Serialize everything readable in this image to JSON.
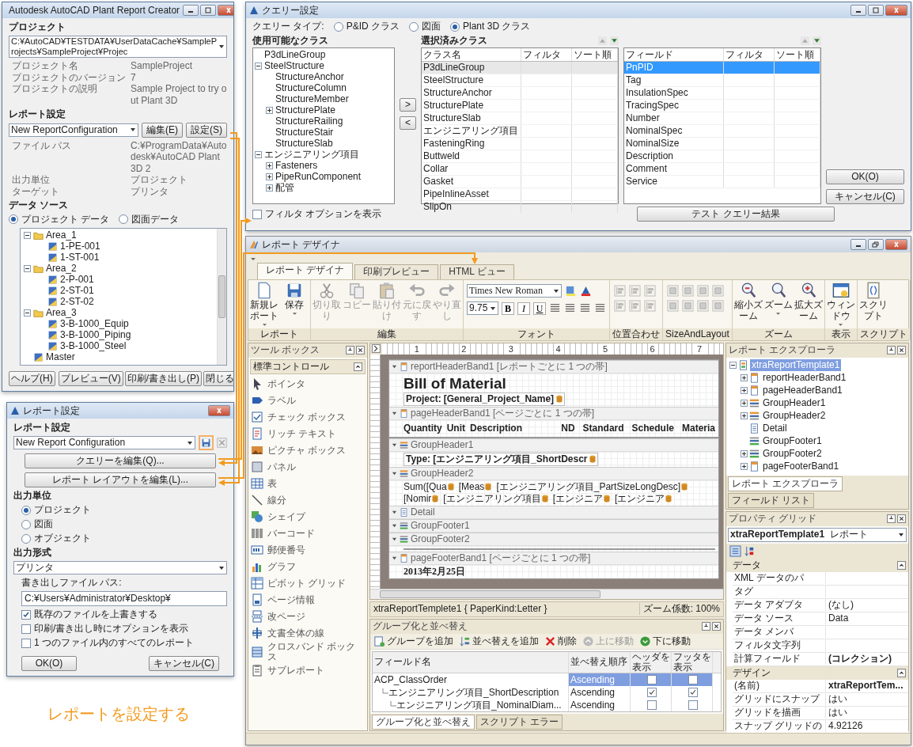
{
  "caption": "レポートを設定する",
  "creator": {
    "title": "Autodesk AutoCAD Plant Report Creator",
    "project_label": "プロジェクト",
    "project_path": "C:¥AutoCAD¥TESTDATA¥UserDataCache¥SampleProjects¥SampleProject¥Projec",
    "project_info": [
      {
        "label": "プロジェクト名",
        "value": "SampleProject"
      },
      {
        "label": "プロジェクトのバージョン",
        "value": "7"
      },
      {
        "label": "プロジェクトの説明",
        "value": "Sample Project to try out Plant 3D"
      }
    ],
    "report_label": "レポート設定",
    "report_config": "New ReportConfiguration",
    "report_buttons": [
      "編集(E)",
      "設定(S)"
    ],
    "report_info": [
      {
        "label": "ファイル パス",
        "value": "C:¥ProgramData¥Autodesk¥AutoCAD Plant 3D 2"
      },
      {
        "label": "出力単位",
        "value": "プロジェクト"
      },
      {
        "label": "ターゲット",
        "value": "プリンタ"
      }
    ],
    "datasource_label": "データ ソース",
    "datasource_options": [
      {
        "label": "プロジェクト データ",
        "selected": true
      },
      {
        "label": "図面データ",
        "selected": false
      }
    ],
    "tree": [
      {
        "label": "Area_1",
        "kind": "folder",
        "expanded": true,
        "children": [
          {
            "label": "1-PE-001",
            "kind": "drawing"
          },
          {
            "label": "1-ST-001",
            "kind": "drawing"
          }
        ]
      },
      {
        "label": "Area_2",
        "kind": "folder",
        "expanded": true,
        "children": [
          {
            "label": "2-P-001",
            "kind": "drawing"
          },
          {
            "label": "2-ST-01",
            "kind": "drawing"
          },
          {
            "label": "2-ST-02",
            "kind": "drawing"
          }
        ]
      },
      {
        "label": "Area_3",
        "kind": "folder",
        "expanded": true,
        "children": [
          {
            "label": "3-B-1000_Equip",
            "kind": "drawing"
          },
          {
            "label": "3-B-1000_Piping",
            "kind": "drawing"
          },
          {
            "label": "3-B-1000_Steel",
            "kind": "drawing"
          }
        ]
      },
      {
        "label": "Master",
        "kind": "drawing"
      }
    ],
    "help_button": "ヘルプ(H)",
    "buttons": [
      "プレビュー(V)",
      "印刷/書き出し(P)",
      "閉じる"
    ]
  },
  "settings": {
    "title": "レポート設定",
    "config_label": "レポート設定",
    "config": "New Report Configuration",
    "edit_buttons": [
      "クエリーを編集(Q)...",
      "レポート レイアウトを編集(L)..."
    ],
    "unit_label": "出力単位",
    "units": [
      {
        "label": "プロジェクト",
        "selected": true
      },
      {
        "label": "図面",
        "selected": false
      },
      {
        "label": "オブジェクト",
        "selected": false
      }
    ],
    "format_label": "出力形式",
    "format": "プリンタ",
    "path_label": "書き出しファイル パス:",
    "path": "C:¥Users¥Administrator¥Desktop¥",
    "options": [
      {
        "label": "既存のファイルを上書きする",
        "checked": true
      },
      {
        "label": "印刷/書き出し時にオプションを表示",
        "checked": false
      },
      {
        "label": "1 つのファイル内のすべてのレポート",
        "checked": false
      }
    ],
    "buttons": [
      "OK(O)",
      "キャンセル(C)"
    ]
  },
  "query": {
    "title": "クエリー設定",
    "type_label": "クエリー タイプ:",
    "types": [
      {
        "label": "P&ID クラス",
        "selected": false
      },
      {
        "label": "図面",
        "selected": false
      },
      {
        "label": "Plant 3D クラス",
        "selected": true
      }
    ],
    "available_label": "使用可能なクラス",
    "available": [
      {
        "label": "P3dLineGroup"
      },
      {
        "label": "SteelStructure",
        "expanded": true,
        "children": [
          {
            "label": "StructureAnchor"
          },
          {
            "label": "StructureColumn"
          },
          {
            "label": "StructureMember"
          },
          {
            "label": "StructurePlate",
            "expanded": false
          },
          {
            "label": "StructureRailing"
          },
          {
            "label": "StructureStair"
          },
          {
            "label": "StructureSlab"
          }
        ]
      },
      {
        "label": "エンジニアリング項目",
        "expanded": true,
        "children": [
          {
            "label": "Fasteners",
            "expanded": false
          },
          {
            "label": "PipeRunComponent",
            "expanded": false
          },
          {
            "label": "配管",
            "expanded": false
          }
        ]
      }
    ],
    "move_buttons": [
      ">",
      "<"
    ],
    "selected_label": "選択済みクラス",
    "class_columns": [
      "クラス名",
      "フィルタ",
      "ソート順"
    ],
    "classes": [
      {
        "name": "P3dLineGroup",
        "selected": true
      },
      {
        "name": "SteelStructure",
        "selected": false
      },
      {
        "name": "StructureAnchor",
        "selected": false
      },
      {
        "name": "StructurePlate",
        "selected": false
      },
      {
        "name": "StructureSlab",
        "selected": false
      },
      {
        "name": "エンジニアリング項目",
        "selected": false
      },
      {
        "name": "FasteningRing",
        "selected": false
      },
      {
        "name": "Buttweld",
        "selected": false
      },
      {
        "name": "Collar",
        "selected": false
      },
      {
        "name": "Gasket",
        "selected": false
      },
      {
        "name": "PipeInlineAsset",
        "selected": false
      },
      {
        "name": "SlipOn",
        "selected": false
      }
    ],
    "field_columns": [
      "フィールド",
      "フィルタ",
      "ソート順"
    ],
    "fields": [
      {
        "name": "PnPID",
        "selected": true
      },
      {
        "name": "Tag",
        "selected": false
      },
      {
        "name": "InsulationSpec",
        "selected": false
      },
      {
        "name": "TracingSpec",
        "selected": false
      },
      {
        "name": "Number",
        "selected": false
      },
      {
        "name": "NominalSpec",
        "selected": false
      },
      {
        "name": "NominalSize",
        "selected": false
      },
      {
        "name": "Description",
        "selected": false
      },
      {
        "name": "Comment",
        "selected": false
      },
      {
        "name": "Service",
        "selected": false
      }
    ],
    "test_button": "テスト クエリー結果",
    "show_option": {
      "label": "フィルタ オプションを表示",
      "checked": false
    },
    "buttons": [
      "OK(O)",
      "キャンセル(C)"
    ]
  },
  "designer": {
    "title": "レポート デザイナ",
    "tabs": [
      {
        "label": "レポート デザイナ",
        "selected": true
      },
      {
        "label": "印刷プレビュー",
        "selected": false
      },
      {
        "label": "HTML ビュー",
        "selected": false
      }
    ],
    "ribbon": [
      {
        "kind": "buttons",
        "label": "レポート",
        "items": [
          {
            "label": "新規レポート",
            "kind": "new",
            "disabled": false,
            "dropdown": true
          },
          {
            "label": "保存",
            "kind": "save",
            "disabled": false,
            "dropdown": true
          }
        ]
      },
      {
        "kind": "buttons",
        "label": "編集",
        "items": [
          {
            "label": "切り取り",
            "kind": "cut",
            "disabled": true,
            "dropdown": false
          },
          {
            "label": "コピー",
            "kind": "copy",
            "disabled": true,
            "dropdown": false
          },
          {
            "label": "貼り付け",
            "kind": "paste",
            "disabled": true,
            "dropdown": false
          },
          {
            "label": "元に戻す",
            "kind": "undo",
            "disabled": true,
            "dropdown": false
          },
          {
            "label": "やり直し",
            "kind": "redo",
            "disabled": true,
            "dropdown": false
          }
        ]
      },
      {
        "kind": "font",
        "label": "フォント",
        "font": "Times New Roman",
        "size": "9.75",
        "styles": [
          "B",
          "I",
          "U"
        ]
      },
      {
        "kind": "align",
        "label": "位置合わせ"
      },
      {
        "kind": "layout",
        "label": "SizeAndLayout"
      },
      {
        "kind": "buttons",
        "label": "ズーム",
        "items": [
          {
            "label": "縮小ズーム",
            "kind": "zoom-out",
            "disabled": false,
            "dropdown": false
          },
          {
            "label": "ズーム",
            "kind": "zoom",
            "disabled": false,
            "dropdown": true
          },
          {
            "label": "拡大ズーム",
            "kind": "zoom-in",
            "disabled": false,
            "dropdown": false
          }
        ]
      },
      {
        "kind": "buttons",
        "label": "表示",
        "items": [
          {
            "label": "ウィンドウ",
            "kind": "window",
            "disabled": false,
            "dropdown": true
          }
        ]
      },
      {
        "kind": "buttons",
        "label": "スクリプト",
        "items": [
          {
            "label": "スクリプト",
            "kind": "script",
            "disabled": false,
            "dropdown": false
          }
        ]
      }
    ],
    "toolbox": {
      "title": "ツール ボックス",
      "category": "標準コントロール",
      "items": [
        {
          "label": "ポインタ",
          "kind": "pointer"
        },
        {
          "label": "ラベル",
          "kind": "label"
        },
        {
          "label": "チェック ボックス",
          "kind": "checkbox"
        },
        {
          "label": "リッチ テキスト",
          "kind": "rich-text"
        },
        {
          "label": "ピクチャ ボックス",
          "kind": "picture-box"
        },
        {
          "label": "パネル",
          "kind": "panel"
        },
        {
          "label": "表",
          "kind": "table"
        },
        {
          "label": "線分",
          "kind": "line"
        },
        {
          "label": "シェイプ",
          "kind": "shape"
        },
        {
          "label": "バーコード",
          "kind": "barcode"
        },
        {
          "label": "郵便番号",
          "kind": "zip-code"
        },
        {
          "label": "グラフ",
          "kind": "chart"
        },
        {
          "label": "ピボット グリッド",
          "kind": "pivot-grid"
        },
        {
          "label": "ページ情報",
          "kind": "page-info"
        },
        {
          "label": "改ページ",
          "kind": "page-break"
        },
        {
          "label": "文書全体の線",
          "kind": "cross-band-line"
        },
        {
          "label": "クロスバンド ボックス",
          "kind": "cross-band-box"
        },
        {
          "label": "サブレポート",
          "kind": "subreport"
        }
      ]
    },
    "ruler_marks": [
      "1",
      "2",
      "3",
      "4",
      "5",
      "6",
      "7"
    ],
    "bands": [
      {
        "label": "reportHeaderBand1 [レポートごとに 1 つの帯]",
        "kind": "report-header",
        "title": "Bill of Material",
        "field_label": "Project:",
        "field": "[General_Project_Name]"
      },
      {
        "label": "pageHeaderBand1 [ページごとに 1 つの帯]",
        "kind": "page-header",
        "columns_left": [
          "Quantity",
          "Unit",
          "Description"
        ],
        "columns_right": [
          "ND",
          "Standard",
          "Schedule",
          "Materia"
        ]
      },
      {
        "label": "GroupHeader1",
        "kind": "group-header",
        "field_label": "Type:",
        "field": "[エンジニアリング項目_ShortDescr"
      },
      {
        "label": "GroupHeader2",
        "kind": "group-header",
        "fields": [
          "Sum([Qua",
          "[Meas",
          "[エンジニアリング項目_PartSizeLongDesc]",
          "[Nomir",
          "[エンジニアリング項目",
          "[エンジニア",
          "[エンジニア"
        ]
      },
      {
        "label": "Detail",
        "kind": "detail"
      },
      {
        "label": "GroupFooter1",
        "kind": "group-footer",
        "rule": false
      },
      {
        "label": "GroupFooter2",
        "kind": "group-footer",
        "rule": true
      },
      {
        "label": "pageFooterBand1 [ページごとに 1 つの帯]",
        "kind": "page-footer",
        "text": "2013年2月25日"
      }
    ],
    "status": "xtraReportTemplete1 { PaperKind:Letter }",
    "zoom": "ズーム係数: 100%",
    "explorer": {
      "title": "レポート エクスプローラ",
      "tree": [
        {
          "label": "xtraReportTemplate1",
          "kind": "report",
          "selected": true,
          "expanded": true,
          "children": [
            {
              "label": "reportHeaderBand1",
              "kind": "report-header",
              "selected": false,
              "expanded": false
            },
            {
              "label": "pageHeaderBand1",
              "kind": "page-header",
              "selected": false,
              "expanded": false
            },
            {
              "label": "GroupHeader1",
              "kind": "group-header",
              "selected": false,
              "expanded": false
            },
            {
              "label": "GroupHeader2",
              "kind": "group-header",
              "selected": false,
              "expanded": false
            },
            {
              "label": "Detail",
              "kind": "detail",
              "selected": false
            },
            {
              "label": "GroupFooter1",
              "kind": "group-footer",
              "selected": false
            },
            {
              "label": "GroupFooter2",
              "kind": "group-footer",
              "selected": false,
              "expanded": false
            },
            {
              "label": "pageFooterBand1",
              "kind": "page-footer",
              "selected": false,
              "expanded": false
            }
          ]
        }
      ],
      "tabs": [
        {
          "label": "レポート エクスプローラ",
          "selected": true
        },
        {
          "label": "フィールド リスト",
          "selected": false
        }
      ]
    },
    "properties": {
      "title": "プロパティ グリッド",
      "object": "xtraReportTemplate1",
      "object_type": "レポート",
      "categories": [
        {
          "name": "データ",
          "expanded": true,
          "rows": [
            {
              "name": "XML データのパ"
            },
            {
              "name": "タグ"
            },
            {
              "name": "データ アダプタ",
              "value": "(なし)",
              "bold": false
            },
            {
              "name": "データ ソース",
              "value": "Data",
              "bold": false
            },
            {
              "name": "データ メンバ"
            },
            {
              "name": "フィルタ文字列"
            },
            {
              "name": "計算フィールド",
              "value": "(コレクション)",
              "bold": true
            }
          ]
        },
        {
          "name": "デザイン",
          "expanded": true,
          "rows": [
            {
              "name": "(名前)",
              "value": "xtraReportTem...",
              "bold": true
            },
            {
              "name": "グリッドにスナップ",
              "value": "はい",
              "bold": false
            },
            {
              "name": "グリッドを描画",
              "value": "はい",
              "bold": false
            },
            {
              "name": "スナップ グリッドの",
              "value": "4.92126",
              "bold": false
            }
          ]
        }
      ]
    },
    "grouping": {
      "title": "グループ化と並べ替え",
      "toolbar": [
        {
          "label": "グループを追加",
          "kind": "add-group",
          "disabled": false
        },
        {
          "label": "並べ替えを追加",
          "kind": "add-sort",
          "disabled": false
        },
        {
          "label": "削除",
          "kind": "delete",
          "disabled": false
        },
        {
          "label": "上に移動",
          "kind": "move-up",
          "disabled": true
        },
        {
          "label": "下に移動",
          "kind": "move-down",
          "disabled": false
        }
      ],
      "columns": [
        "フィールド名",
        "並べ替え順序",
        "ヘッダを表示",
        "フッタを表示"
      ],
      "rows": [
        {
          "field": "ACP_ClassOrder",
          "order": "Ascending",
          "header": false,
          "footer": false,
          "selected": true,
          "children": [
            {
              "field": "エンジニアリング項目_ShortDescription",
              "order": "Ascending",
              "header": true,
              "footer": true,
              "selected": false,
              "children": [
                {
                  "field": "エンジニアリング項目_NominalDiam...",
                  "order": "Ascending",
                  "header": false,
                  "footer": false,
                  "selected": false
                }
              ]
            }
          ]
        }
      ],
      "tabs": [
        {
          "label": "グループ化と並べ替え",
          "selected": true
        },
        {
          "label": "スクリプト エラー",
          "selected": false
        }
      ]
    }
  }
}
